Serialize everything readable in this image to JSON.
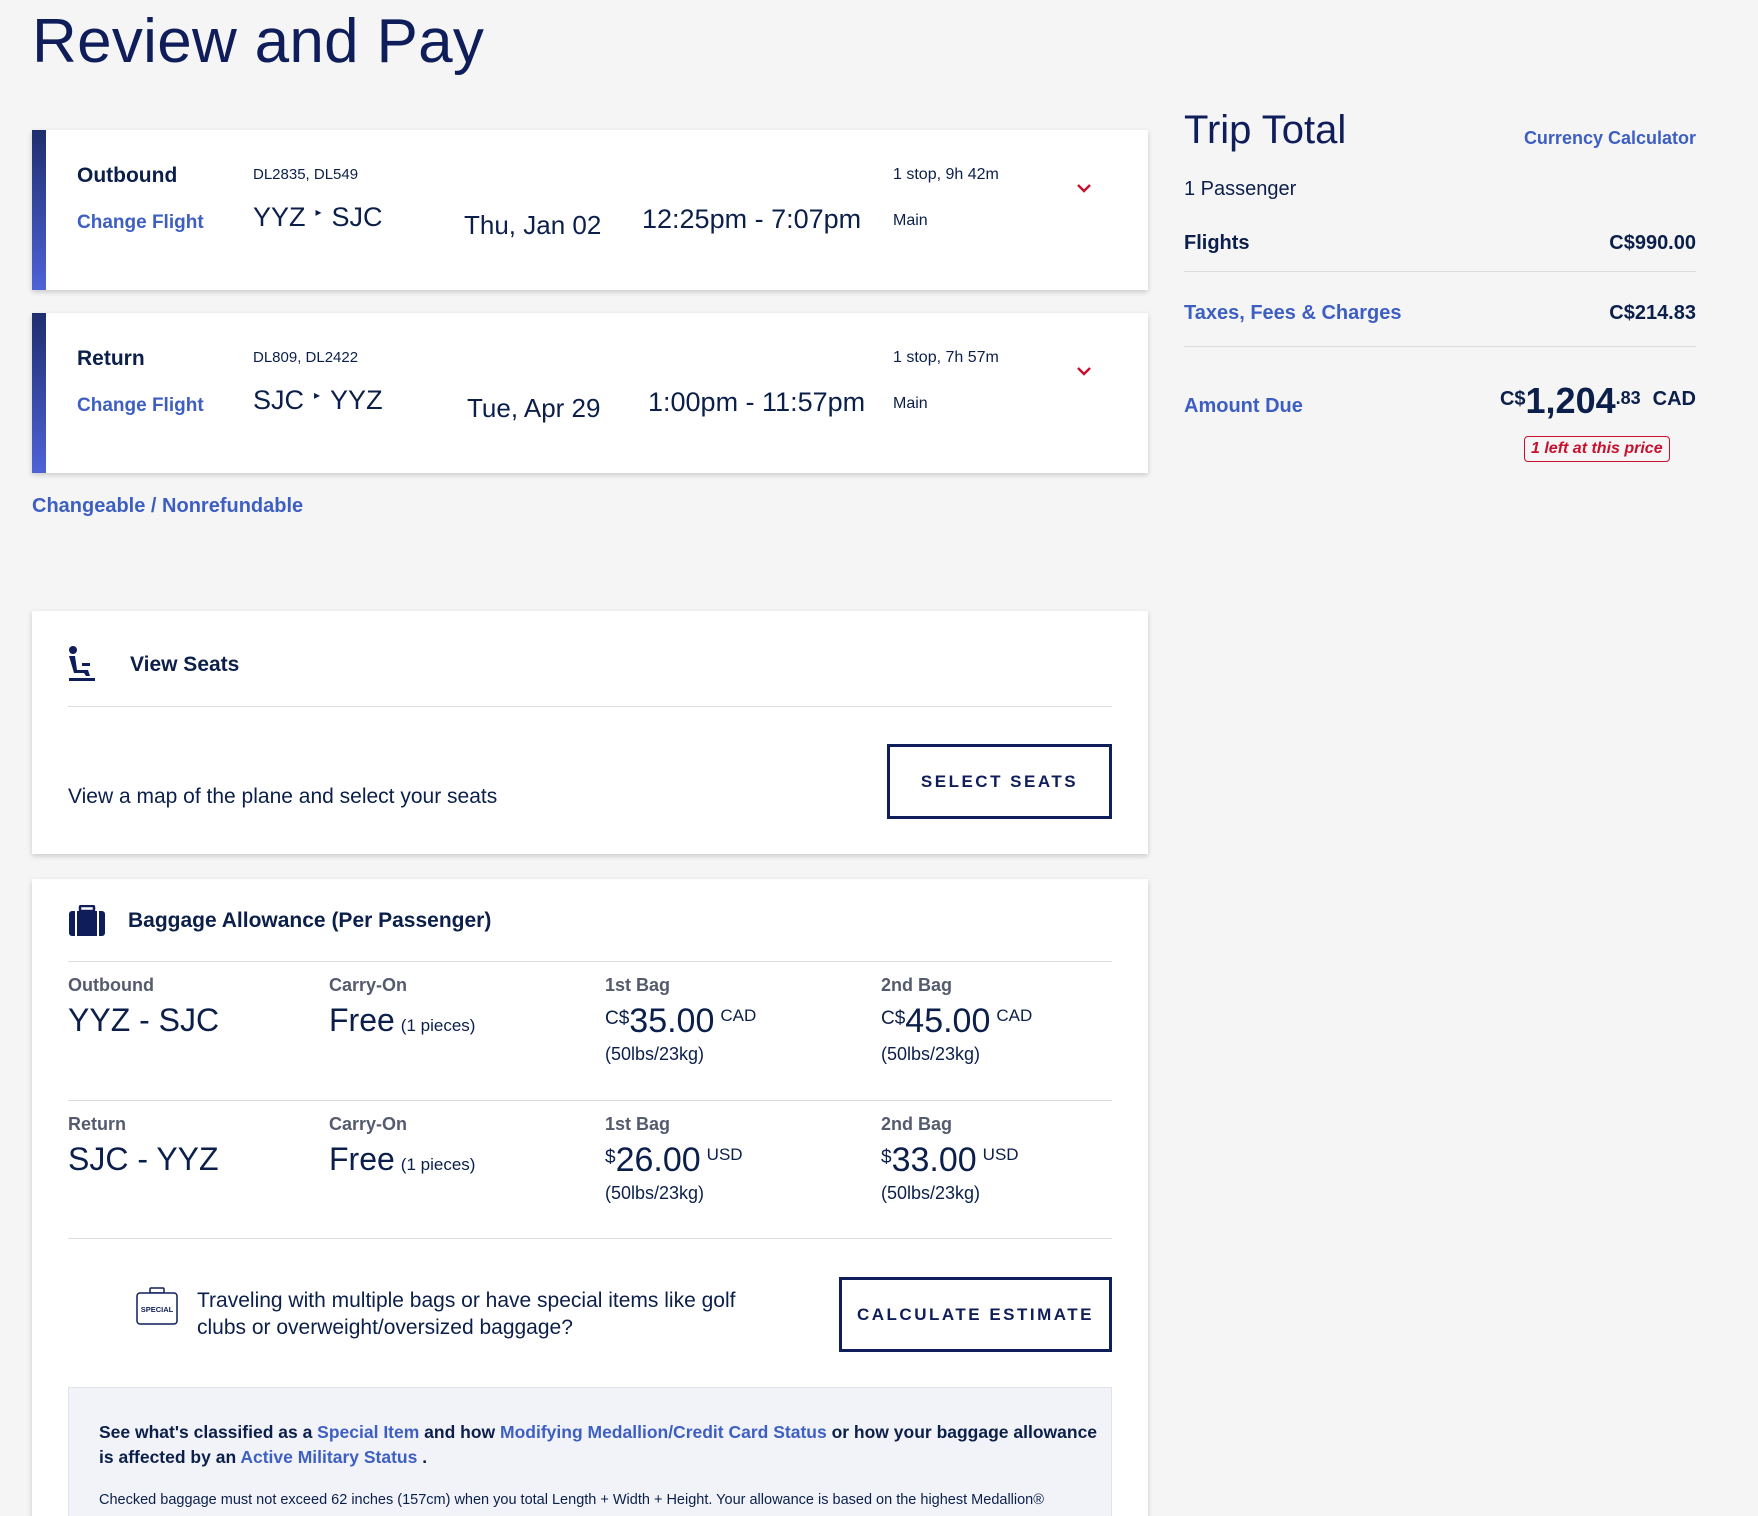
{
  "page": {
    "title": "Review and Pay"
  },
  "outbound": {
    "label": "Outbound",
    "change": "Change Flight",
    "flight_numbers": "DL2835, DL549",
    "from": "YYZ",
    "to": "SJC",
    "date": "Thu, Jan 02",
    "time": "12:25pm - 7:07pm",
    "stops": "1 stop, 9h 42m",
    "cabin": "Main"
  },
  "return": {
    "label": "Return",
    "change": "Change Flight",
    "flight_numbers": "DL809, DL2422",
    "from": "SJC",
    "to": "YYZ",
    "date": "Tue, Apr 29",
    "time": "1:00pm - 11:57pm",
    "stops": "1 stop, 7h 57m",
    "cabin": "Main"
  },
  "fare_rules": "Changeable / Nonrefundable",
  "trip_total": {
    "title": "Trip Total",
    "currency_calculator": "Currency Calculator",
    "passengers": "1 Passenger",
    "flights_label": "Flights",
    "flights_value": "C$990.00",
    "taxes_label": "Taxes, Fees & Charges",
    "taxes_value": "C$214.83",
    "amount_label": "Amount Due",
    "amount_currency": "C$",
    "amount_int": "1,204",
    "amount_dec": ".83",
    "amount_code": "CAD",
    "badge": "1 left at this price"
  },
  "seats": {
    "title": "View Seats",
    "description": "View a map of the plane and select your seats",
    "button": "SELECT SEATS"
  },
  "baggage": {
    "title": "Baggage Allowance (Per Passenger)",
    "rows": [
      {
        "direction": "Outbound",
        "route": "YYZ - SJC",
        "carry_label": "Carry-On",
        "carry_value": "Free",
        "carry_note": "(1 pieces)",
        "bag1_label": "1st Bag",
        "bag1_cur": "C$",
        "bag1_amt": "35.00",
        "bag1_code": "CAD",
        "bag1_weight": "(50lbs/23kg)",
        "bag2_label": "2nd Bag",
        "bag2_cur": "C$",
        "bag2_amt": "45.00",
        "bag2_code": "CAD",
        "bag2_weight": "(50lbs/23kg)"
      },
      {
        "direction": "Return",
        "route": "SJC - YYZ",
        "carry_label": "Carry-On",
        "carry_value": "Free",
        "carry_note": "(1 pieces)",
        "bag1_label": "1st Bag",
        "bag1_cur": "$",
        "bag1_amt": "26.00",
        "bag1_code": "USD",
        "bag1_weight": "(50lbs/23kg)",
        "bag2_label": "2nd Bag",
        "bag2_cur": "$",
        "bag2_amt": "33.00",
        "bag2_code": "USD",
        "bag2_weight": "(50lbs/23kg)"
      }
    ],
    "special_icon_label": "SPECIAL",
    "special_text": "Traveling with multiple bags or have special items like golf clubs or overweight/oversized baggage?",
    "estimate_button": "CALCULATE ESTIMATE",
    "info": {
      "t1": "See what's classified as a ",
      "link1": "Special Item",
      "t2": " and how ",
      "link2": "Modifying Medallion/Credit Card Status",
      "t3": " or how your baggage allowance is affected by an ",
      "link3": "Active Military Status",
      "t4": " .",
      "note": "Checked baggage must not exceed 62 inches (157cm) when you total Length + Width + Height. Your allowance is based on the highest Medallion®"
    }
  },
  "colors": {
    "navy": "#0f1e5a",
    "link": "#3e5fc2",
    "alert": "#c8102e"
  }
}
